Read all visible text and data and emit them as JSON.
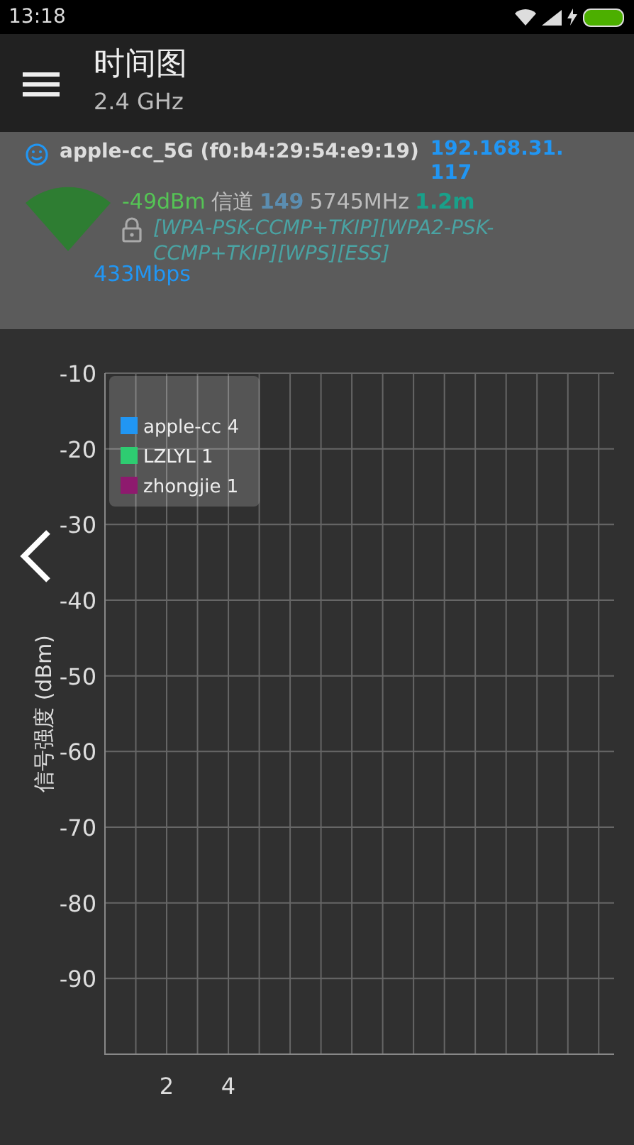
{
  "status_bar": {
    "time": "13:18"
  },
  "app_bar": {
    "title": "时间图",
    "subtitle": "2.4 GHz"
  },
  "network": {
    "ssid": "apple-cc_5G (f0:b4:29:54:e9:19)",
    "ip": "192.168.31.117",
    "signal": "-49dBm",
    "channel_label": "信道",
    "channel": "149",
    "frequency": "5745MHz",
    "distance": "1.2m",
    "security": "[WPA-PSK-CCMP+TKIP][WPA2-PSK-CCMP+TKIP][WPS][ESS]",
    "speed": "433Mbps",
    "color": "#2e7d32"
  },
  "chart_data": {
    "type": "line",
    "ylabel": "信号强度 (dBm)",
    "grid": true,
    "categories": [
      "2",
      "4"
    ],
    "ylim": [
      -100,
      -10
    ],
    "yticks": [
      -10,
      -20,
      -30,
      -40,
      -50,
      -60,
      -70,
      -80,
      -90
    ],
    "series": [
      {
        "name": "apple-cc 4",
        "color": "#2196f3",
        "values": [
          null,
          null
        ]
      },
      {
        "name": "LZLYL 1",
        "color": "#2ecc71",
        "values": [
          null,
          null
        ]
      },
      {
        "name": "zhongjie 1",
        "color": "#8e1a6e",
        "values": [
          null,
          null
        ]
      }
    ]
  }
}
